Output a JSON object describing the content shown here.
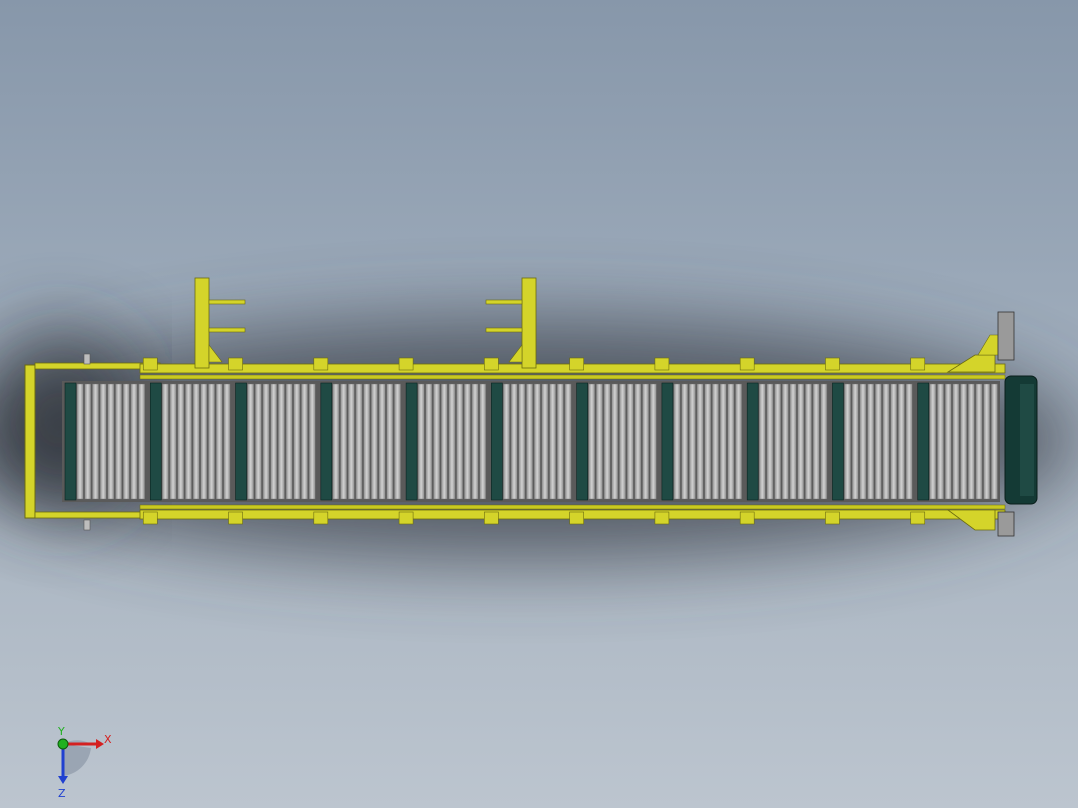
{
  "viewport": {
    "background_top": "#8797aa",
    "background_bottom": "#bcc5cf",
    "frame_color": "#d4d42a",
    "frame_dark": "#8a8a10",
    "roller_color": "#b9b9b9",
    "roller_dark": "#6e6e6e",
    "belt_color": "#1f4a44",
    "end_cap_color": "#143a35"
  },
  "model": {
    "name": "conveyor-assembly",
    "sections": 11,
    "rollers_per_section": 9
  },
  "triad": {
    "x_label": "X",
    "y_label": "Y",
    "z_label": "Z",
    "x_color": "#d42020",
    "y_color": "#20b020",
    "z_color": "#2040d0"
  }
}
